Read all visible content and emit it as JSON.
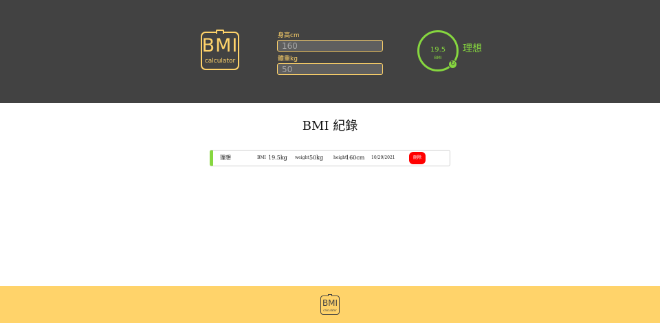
{
  "logo": {
    "title": "BMI",
    "subtitle": "calculator"
  },
  "form": {
    "height_label": "身高cm",
    "height_value": "160",
    "weight_label": "體重kg",
    "weight_value": "50"
  },
  "result": {
    "value": "19.5",
    "unit": "BMI",
    "status": "理想",
    "reset_icon": "refresh-icon",
    "status_color": "#86d73f"
  },
  "records": {
    "title": "BMI 紀錄",
    "items": [
      {
        "status": "理想",
        "bmi_label": "BMI",
        "bmi_value": "19.5kg",
        "weight_label": "weight",
        "weight_value": "50kg",
        "height_label": "height",
        "height_value": "160cm",
        "date": "10/29/2021",
        "delete_label": "刪除"
      }
    ]
  },
  "colors": {
    "header_bg": "#424242",
    "accent": "#ffd36a",
    "ideal": "#86d73f",
    "delete": "#ff0000"
  }
}
